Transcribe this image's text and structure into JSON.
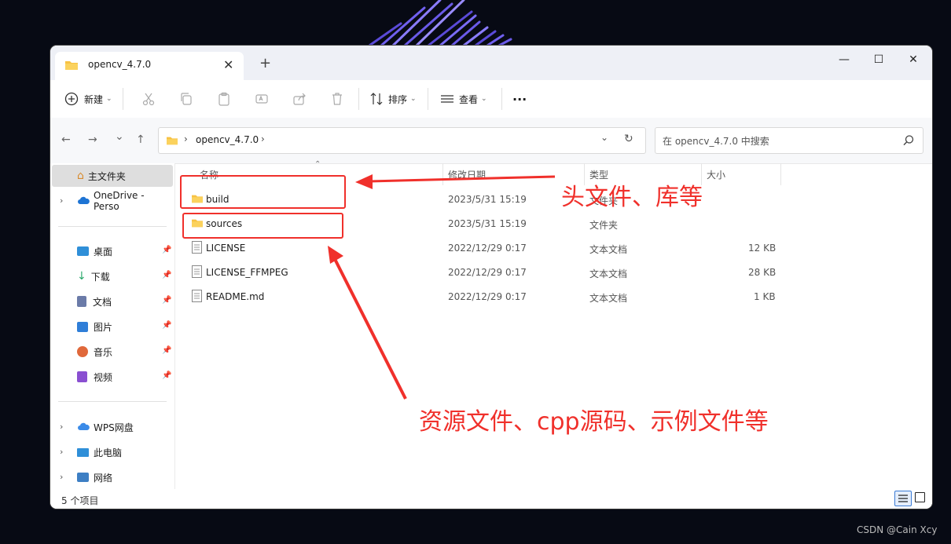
{
  "window": {
    "tab_title": "opencv_4.7.0",
    "tab_close": "✕",
    "new_tab": "+",
    "minimize": "—",
    "maximize": "☐",
    "close": "✕"
  },
  "toolbar": {
    "new_label": "新建",
    "sort_label": "排序",
    "view_label": "查看",
    "more_label": "···"
  },
  "nav": {
    "back": "←",
    "forward": "→",
    "history": "⌄",
    "up": "↑"
  },
  "address": {
    "crumb": "opencv_4.7.0",
    "sep": "›"
  },
  "search": {
    "placeholder": "在 opencv_4.7.0 中搜索"
  },
  "sidebar": {
    "home": "主文件夹",
    "onedrive": "OneDrive - Perso",
    "quick": [
      {
        "label": "桌面",
        "icon": "desktop-icon",
        "color": "#2f8fd8"
      },
      {
        "label": "下载",
        "icon": "download-icon",
        "color": "#2aa86b"
      },
      {
        "label": "文档",
        "icon": "document-icon",
        "color": "#6b7ba8"
      },
      {
        "label": "图片",
        "icon": "picture-icon",
        "color": "#2f7ed8"
      },
      {
        "label": "音乐",
        "icon": "music-icon",
        "color": "#e0683a"
      },
      {
        "label": "视频",
        "icon": "video-icon",
        "color": "#8a4fd1"
      }
    ],
    "wps": "WPS网盘",
    "pc": "此电脑",
    "network": "网络"
  },
  "columns": {
    "name": "名称",
    "modified": "修改日期",
    "type": "类型",
    "size": "大小"
  },
  "files": [
    {
      "name": "build",
      "modified": "2023/5/31 15:19",
      "type": "文件夹",
      "size": "",
      "icon": "folder-icon"
    },
    {
      "name": "sources",
      "modified": "2023/5/31 15:19",
      "type": "文件夹",
      "size": "",
      "icon": "folder-icon"
    },
    {
      "name": "LICENSE",
      "modified": "2022/12/29 0:17",
      "type": "文本文档",
      "size": "12 KB",
      "icon": "text-file-icon"
    },
    {
      "name": "LICENSE_FFMPEG",
      "modified": "2022/12/29 0:17",
      "type": "文本文档",
      "size": "28 KB",
      "icon": "text-file-icon"
    },
    {
      "name": "README.md",
      "modified": "2022/12/29 0:17",
      "type": "文本文档",
      "size": "1 KB",
      "icon": "text-file-icon"
    }
  ],
  "status": {
    "count": "5 个项目"
  },
  "annotations": {
    "top": "头文件、库等",
    "bottom": "资源文件、cpp源码、示例文件等",
    "color": "#f0302b"
  },
  "watermark": "CSDN @Cain Xcy"
}
